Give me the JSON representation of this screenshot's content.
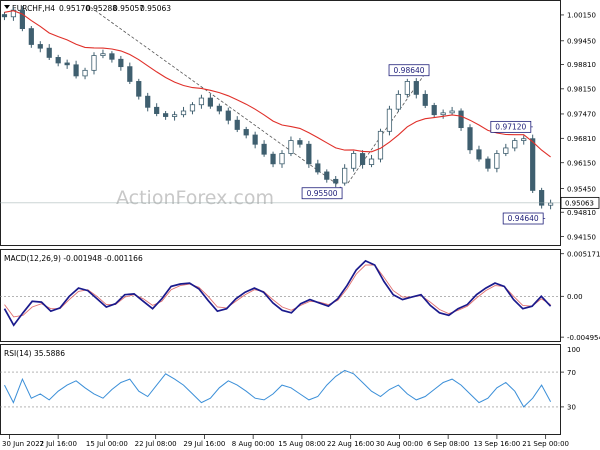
{
  "header": {
    "symbol": "EURCHF,H4",
    "open": "0.95170",
    "high": "0.95288",
    "low": "0.95057",
    "close": "0.95063"
  },
  "watermark": "ActionForex.com",
  "chart_data": [
    {
      "type": "candlestick",
      "title": "EURCHF,H4",
      "x_ticks": [
        "30 Jun 2022",
        "7 Jul 16:00",
        "15 Jul 00:00",
        "22 Jul 08:00",
        "29 Jul 16:00",
        "8 Aug 00:00",
        "15 Aug 08:00",
        "22 Aug 16:00",
        "30 Aug 00:00",
        "6 Sep 08:00",
        "13 Sep 16:00",
        "21 Sep 00:00"
      ],
      "y_ticks": [
        "1.00150",
        "0.99450",
        "0.98810",
        "0.98150",
        "0.97470",
        "0.96810",
        "0.96150",
        "0.95450",
        "0.94810",
        "0.94150"
      ],
      "ylim": [
        0.9395,
        1.005
      ],
      "current_price": "0.95063",
      "x": [
        0,
        4,
        8,
        12,
        16,
        20,
        24,
        28,
        32,
        36,
        40,
        44,
        48,
        52,
        56,
        60,
        64,
        68,
        72,
        76,
        80,
        84,
        88,
        92,
        96,
        100,
        104,
        108,
        112,
        116,
        120,
        124,
        128,
        132,
        136,
        140,
        144,
        148,
        152,
        156,
        160,
        164,
        168,
        172,
        176,
        180,
        184,
        188,
        192,
        196,
        200,
        204,
        208,
        212,
        216,
        220,
        224,
        228,
        232,
        236,
        240,
        244,
        248,
        252,
        256,
        260,
        264,
        268,
        272,
        276,
        280,
        284,
        288,
        292,
        296,
        300,
        304,
        308,
        312,
        316,
        320,
        324,
        328,
        332,
        336,
        340,
        344,
        348,
        352,
        356,
        360,
        364
      ],
      "close": [
        1.001,
        1.0028,
        0.9978,
        0.9935,
        0.9925,
        0.99,
        0.9885,
        0.988,
        0.985,
        0.9865,
        0.9905,
        0.991,
        0.9895,
        0.9875,
        0.9835,
        0.9795,
        0.9765,
        0.9748,
        0.974,
        0.9745,
        0.9755,
        0.9772,
        0.979,
        0.9768,
        0.9755,
        0.973,
        0.9705,
        0.969,
        0.9665,
        0.9638,
        0.9612,
        0.964,
        0.9675,
        0.9665,
        0.9612,
        0.959,
        0.957,
        0.956,
        0.96,
        0.964,
        0.961,
        0.9625,
        0.97,
        0.976,
        0.98,
        0.9835,
        0.98,
        0.977,
        0.9745,
        0.975,
        0.9755,
        0.971,
        0.965,
        0.9625,
        0.96,
        0.964,
        0.9655,
        0.9675,
        0.968,
        0.954,
        0.95,
        0.9506
      ],
      "ma_period": 55,
      "annotations": [
        {
          "label": "0.98640",
          "x": 172,
          "value": 0.9864
        },
        {
          "label": "0.95500",
          "x": 136,
          "value": 0.955
        },
        {
          "label": "0.97120",
          "x": 214,
          "value": 0.9712
        },
        {
          "label": "0.94640",
          "x": 219,
          "value": 0.9464
        }
      ],
      "grid": false
    },
    {
      "type": "line",
      "title": "MACD(12,26,9) -0.001948 -0.001166",
      "y_ticks": [
        "0.005171",
        "0.00",
        "-0.004954"
      ],
      "ylim": [
        -0.0053,
        0.0055
      ],
      "series": [
        {
          "name": "MACD",
          "color": "#1a1a8c"
        },
        {
          "name": "Signal",
          "color": "#e07070"
        }
      ],
      "macd": [
        -0.0015,
        -0.0035,
        -0.002,
        -0.0006,
        -0.0007,
        -0.0018,
        -0.0014,
        0.0,
        0.001,
        0.0007,
        -0.0003,
        -0.0013,
        -0.0009,
        0.0002,
        0.0003,
        -0.0006,
        -0.0015,
        -0.0003,
        0.0012,
        0.0015,
        0.0016,
        0.0009,
        -0.0005,
        -0.0018,
        -0.0015,
        -0.0003,
        0.0005,
        0.001,
        0.0005,
        -0.0008,
        -0.0017,
        -0.002,
        -0.0009,
        -0.0004,
        -0.0008,
        -0.0012,
        -0.0003,
        0.0013,
        0.0032,
        0.0043,
        0.0038,
        0.0018,
        0.0002,
        -0.0004,
        -0.0001,
        0.0002,
        -0.0011,
        -0.002,
        -0.0023,
        -0.0015,
        -0.001,
        0.0002,
        0.001,
        0.0016,
        0.0012,
        -0.0004,
        -0.0015,
        -0.0012,
        0.0,
        -0.0012
      ],
      "signal": [
        -0.001,
        -0.0025,
        -0.0023,
        -0.0013,
        -0.0009,
        -0.0015,
        -0.0015,
        -0.0004,
        0.0006,
        0.0008,
        0.0,
        -0.001,
        -0.001,
        -0.0001,
        0.0002,
        -0.0003,
        -0.0011,
        -0.0006,
        0.0008,
        0.0013,
        0.0015,
        0.0011,
        0.0,
        -0.0013,
        -0.0014,
        -0.0006,
        0.0002,
        0.0008,
        0.0006,
        -0.0004,
        -0.0013,
        -0.0017,
        -0.0011,
        -0.0006,
        -0.0007,
        -0.001,
        -0.0005,
        0.0009,
        0.0027,
        0.0038,
        0.0038,
        0.0023,
        0.0007,
        -0.0001,
        -0.0001,
        0.0001,
        -0.0007,
        -0.0016,
        -0.0021,
        -0.0017,
        -0.0012,
        -0.0002,
        0.0007,
        0.0013,
        0.0012,
        0.0,
        -0.0011,
        -0.0012,
        -0.0003,
        -0.001
      ]
    },
    {
      "type": "line",
      "title": "RSI(14) 35.5886",
      "y_ticks": [
        "70",
        "30"
      ],
      "upper_tick": "100",
      "levels": [
        70,
        30
      ],
      "ylim": [
        0,
        100
      ],
      "series": [
        {
          "name": "RSI",
          "color": "#3b8fd8"
        }
      ],
      "rsi": [
        55,
        35,
        62,
        40,
        45,
        38,
        48,
        55,
        60,
        52,
        45,
        40,
        50,
        58,
        62,
        48,
        42,
        55,
        68,
        62,
        55,
        45,
        35,
        40,
        52,
        60,
        55,
        48,
        40,
        38,
        45,
        55,
        52,
        45,
        38,
        42,
        55,
        65,
        72,
        68,
        58,
        48,
        42,
        50,
        55,
        45,
        38,
        42,
        50,
        58,
        62,
        55,
        45,
        35,
        40,
        52,
        58,
        48,
        30,
        40,
        55,
        36
      ]
    }
  ]
}
